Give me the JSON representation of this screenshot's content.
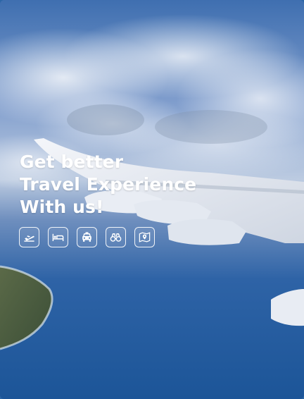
{
  "hero": {
    "headline": {
      "line1": "Get better",
      "line2": "Travel Experience",
      "line3": "With us!"
    },
    "services": [
      {
        "icon": "airplane-departure-icon"
      },
      {
        "icon": "bed-icon"
      },
      {
        "icon": "taxi-icon"
      },
      {
        "icon": "binoculars-icon"
      },
      {
        "icon": "map-pin-icon"
      }
    ]
  },
  "colors": {
    "text": "#ffffff",
    "sky_top": "#3f6fb0",
    "ocean": "#1f5fa6"
  }
}
